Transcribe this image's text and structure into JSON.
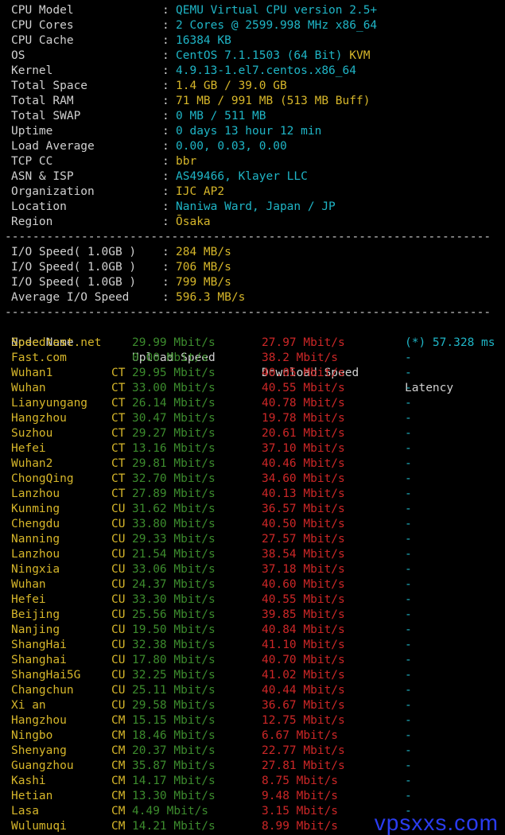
{
  "sysinfo": [
    {
      "key": "CPU Model",
      "value": "QEMU Virtual CPU version 2.5+",
      "color": "cyan"
    },
    {
      "key": "CPU Cores",
      "value": "2 Cores @ 2599.998 MHz x86_64",
      "color": "cyan"
    },
    {
      "key": "CPU Cache",
      "value": "16384 KB",
      "color": "cyan"
    },
    {
      "key": "OS",
      "value": "CentOS 7.1.1503 (64 Bit)",
      "extra": " KVM",
      "color": "cyan"
    },
    {
      "key": "Kernel",
      "value": "4.9.13-1.el7.centos.x86_64",
      "color": "cyan"
    },
    {
      "key": "Total Space",
      "value": "1.4 GB / 39.0 GB",
      "color": "yellow"
    },
    {
      "key": "Total RAM",
      "value": "71 MB / 991 MB (513 MB Buff)",
      "color": "yellow"
    },
    {
      "key": "Total SWAP",
      "value": "0 MB / 511 MB",
      "color": "cyan"
    },
    {
      "key": "Uptime",
      "value": "0 days 13 hour 12 min",
      "color": "cyan"
    },
    {
      "key": "Load Average",
      "value": "0.00, 0.03, 0.00",
      "color": "cyan"
    },
    {
      "key": "TCP CC",
      "value": "bbr",
      "color": "yellow"
    },
    {
      "key": "ASN & ISP",
      "value": "AS49466, Klayer LLC",
      "color": "cyan"
    },
    {
      "key": "Organization",
      "value": "IJC AP2",
      "color": "yellow"
    },
    {
      "key": "Location",
      "value": "Naniwa Ward, Japan / JP",
      "color": "cyan"
    },
    {
      "key": "Region",
      "value": "Ōsaka",
      "color": "yellow"
    }
  ],
  "separator": "----------------------------------------------------------------------",
  "io": [
    {
      "key": "I/O Speed( 1.0GB )",
      "value": "284 MB/s"
    },
    {
      "key": "I/O Speed( 1.0GB )",
      "value": "706 MB/s"
    },
    {
      "key": "I/O Speed( 1.0GB )",
      "value": "799 MB/s"
    },
    {
      "key": "Average I/O Speed",
      "value": "596.3 MB/s"
    }
  ],
  "speed_header": {
    "node": "Node Name",
    "upload": "Upload Speed",
    "download": "Download Speed",
    "latency": "Latency"
  },
  "speed_rows": [
    {
      "node": "Speedtest.net",
      "isp": "",
      "up": "29.99 Mbit/s",
      "down": "27.97 Mbit/s",
      "lat": "(*) 57.328 ms"
    },
    {
      "node": "Fast.com",
      "isp": "",
      "up": "0.00 Mbit/s",
      "down": "38.2 Mbit/s",
      "lat": "-"
    },
    {
      "node": "Wuhan1",
      "isp": "CT",
      "up": "29.95 Mbit/s",
      "down": "40.05 Mbit/s",
      "lat": "-"
    },
    {
      "node": "Wuhan",
      "isp": "CT",
      "up": "33.00 Mbit/s",
      "down": "40.55 Mbit/s",
      "lat": "-"
    },
    {
      "node": "Lianyungang",
      "isp": "CT",
      "up": "26.14 Mbit/s",
      "down": "40.78 Mbit/s",
      "lat": "-"
    },
    {
      "node": "Hangzhou",
      "isp": "CT",
      "up": "30.47 Mbit/s",
      "down": "19.78 Mbit/s",
      "lat": "-"
    },
    {
      "node": "Suzhou",
      "isp": "CT",
      "up": "29.27 Mbit/s",
      "down": "20.61 Mbit/s",
      "lat": "-"
    },
    {
      "node": "Hefei",
      "isp": "CT",
      "up": "13.16 Mbit/s",
      "down": "37.10 Mbit/s",
      "lat": "-"
    },
    {
      "node": "Wuhan2",
      "isp": "CT",
      "up": "29.81 Mbit/s",
      "down": "40.46 Mbit/s",
      "lat": "-"
    },
    {
      "node": "ChongQing",
      "isp": "CT",
      "up": "32.70 Mbit/s",
      "down": "34.60 Mbit/s",
      "lat": "-"
    },
    {
      "node": "Lanzhou",
      "isp": "CT",
      "up": "27.89 Mbit/s",
      "down": "40.13 Mbit/s",
      "lat": "-"
    },
    {
      "node": "Kunming",
      "isp": "CU",
      "up": "31.62 Mbit/s",
      "down": "36.57 Mbit/s",
      "lat": "-"
    },
    {
      "node": "Chengdu",
      "isp": "CU",
      "up": "33.80 Mbit/s",
      "down": "40.50 Mbit/s",
      "lat": "-"
    },
    {
      "node": "Nanning",
      "isp": "CU",
      "up": "29.33 Mbit/s",
      "down": "27.57 Mbit/s",
      "lat": "-"
    },
    {
      "node": "Lanzhou",
      "isp": "CU",
      "up": "21.54 Mbit/s",
      "down": "38.54 Mbit/s",
      "lat": "-"
    },
    {
      "node": "Ningxia",
      "isp": "CU",
      "up": "33.06 Mbit/s",
      "down": "37.18 Mbit/s",
      "lat": "-"
    },
    {
      "node": "Wuhan",
      "isp": "CU",
      "up": "24.37 Mbit/s",
      "down": "40.60 Mbit/s",
      "lat": "-"
    },
    {
      "node": "Hefei",
      "isp": "CU",
      "up": "33.30 Mbit/s",
      "down": "40.55 Mbit/s",
      "lat": "-"
    },
    {
      "node": "Beijing",
      "isp": "CU",
      "up": "25.56 Mbit/s",
      "down": "39.85 Mbit/s",
      "lat": "-"
    },
    {
      "node": "Nanjing",
      "isp": "CU",
      "up": "19.50 Mbit/s",
      "down": "40.84 Mbit/s",
      "lat": "-"
    },
    {
      "node": "ShangHai",
      "isp": "CU",
      "up": "32.38 Mbit/s",
      "down": "41.10 Mbit/s",
      "lat": "-"
    },
    {
      "node": "Shanghai",
      "isp": "CU",
      "up": "17.80 Mbit/s",
      "down": "40.70 Mbit/s",
      "lat": "-"
    },
    {
      "node": "ShangHai5G",
      "isp": "CU",
      "up": "32.25 Mbit/s",
      "down": "41.02 Mbit/s",
      "lat": "-"
    },
    {
      "node": "Changchun",
      "isp": "CU",
      "up": "25.11 Mbit/s",
      "down": "40.44 Mbit/s",
      "lat": "-"
    },
    {
      "node": "Xi an",
      "isp": "CU",
      "up": "29.58 Mbit/s",
      "down": "36.67 Mbit/s",
      "lat": "-"
    },
    {
      "node": "Hangzhou",
      "isp": "CM",
      "up": "15.15 Mbit/s",
      "down": "12.75 Mbit/s",
      "lat": "-"
    },
    {
      "node": "Ningbo",
      "isp": "CM",
      "up": "18.46 Mbit/s",
      "down": "6.67 Mbit/s",
      "lat": "-"
    },
    {
      "node": "Shenyang",
      "isp": "CM",
      "up": "20.37 Mbit/s",
      "down": "22.77 Mbit/s",
      "lat": "-"
    },
    {
      "node": "Guangzhou",
      "isp": "CM",
      "up": "35.87 Mbit/s",
      "down": "27.81 Mbit/s",
      "lat": "-"
    },
    {
      "node": "Kashi",
      "isp": "CM",
      "up": "14.17 Mbit/s",
      "down": "8.75 Mbit/s",
      "lat": "-"
    },
    {
      "node": "Hetian",
      "isp": "CM",
      "up": "13.30 Mbit/s",
      "down": "9.48 Mbit/s",
      "lat": "-"
    },
    {
      "node": "Lasa",
      "isp": "CM",
      "up": "4.49 Mbit/s",
      "down": "3.15 Mbit/s",
      "lat": "-"
    },
    {
      "node": "Wulumuqi",
      "isp": "CM",
      "up": "14.21 Mbit/s",
      "down": "8.99 Mbit/s",
      "lat": "-"
    }
  ],
  "watermark": "vpsxxs.com",
  "colors": {
    "background": "#000000",
    "label": "#d0d0d0",
    "cyan": "#1fb5c6",
    "yellow": "#d6b62a",
    "green": "#3c8b2d",
    "red": "#cc2727",
    "watermark": "#2a3cf0"
  }
}
